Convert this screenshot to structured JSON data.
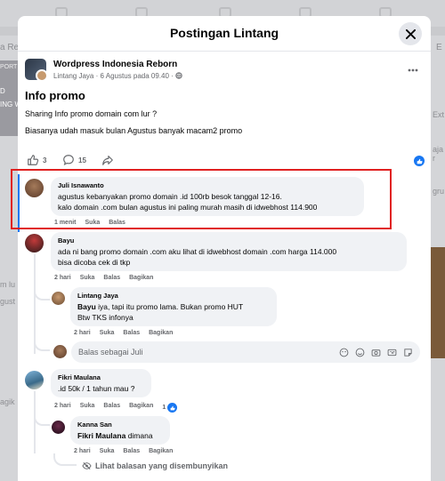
{
  "modal": {
    "title": "Postingan Lintang"
  },
  "post": {
    "group_name": "Wordpress Indonesia Reborn",
    "author": "Lintang Jaya",
    "separator": "·",
    "date": "6 Agustus pada 09.40",
    "separator2": "·",
    "title": "Info promo",
    "lines": [
      "Sharing Info promo domain com lur ?",
      "Biasanya udah masuk bulan Agustus banyak macam2 promo"
    ],
    "likes": "3",
    "comments_count": "15"
  },
  "comments": [
    {
      "name": "Juli Isnawanto",
      "lines": [
        "agustus kebanyakan promo domain .id 100rb besok tanggal 12-16.",
        "kalo domain .com bulan agustus ini paling murah masih di idwebhost 114.900"
      ],
      "time": "1 menit",
      "actions": [
        "Suka",
        "Balas"
      ]
    },
    {
      "name": "Bayu",
      "lines": [
        "ada ni bang promo domain .com aku lihat di idwebhost domain .com harga 114.000",
        "bisa dicoba cek di tkp"
      ],
      "time": "2 hari",
      "actions": [
        "Suka",
        "Balas",
        "Bagikan"
      ]
    },
    {
      "name": "Lintang Jaya",
      "mention": "Bayu",
      "line1_rest": " iya, tapi itu promo lama. Bukan promo HUT",
      "line2": "Btw TKS infonya",
      "time": "2 hari",
      "actions": [
        "Suka",
        "Balas",
        "Bagikan"
      ]
    },
    {
      "name": "Fikri Maulana",
      "lines": [
        ".id 50k / 1 tahun mau ?"
      ],
      "time": "2 hari",
      "actions": [
        "Suka",
        "Balas",
        "Bagikan"
      ],
      "reactions": "1"
    },
    {
      "name": "Kanna San",
      "mention": "Fikri Maulana",
      "rest": " dimana",
      "time": "2 hari",
      "actions": [
        "Suka",
        "Balas",
        "Bagikan"
      ]
    }
  ],
  "reply_box": {
    "placeholder": "Balas sebagai Juli"
  },
  "hidden_replies": "Lihat balasan yang disembunyikan",
  "background": {
    "left_text_1": "a Re",
    "left_text_2": "PORT",
    "left_text_3": "D",
    "left_text_4": "ING W",
    "left_text_5": "m lu",
    "left_text_6": "gust",
    "left_text_7": "agik",
    "right_text_1": "E",
    "right_text_2": "Ext",
    "right_text_3": "aja r",
    "right_text_4": "gru"
  },
  "colors": {
    "accent": "#1877f2",
    "highlight_box": "#e02020",
    "bubble": "#f0f2f5",
    "muted_text": "#65676b"
  }
}
